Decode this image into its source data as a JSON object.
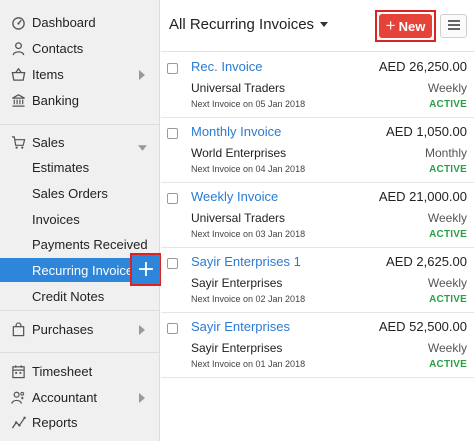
{
  "sidebar": {
    "items": [
      {
        "label": "Dashboard",
        "icon": "dashboard-icon"
      },
      {
        "label": "Contacts",
        "icon": "person-icon"
      },
      {
        "label": "Items",
        "icon": "basket-icon"
      },
      {
        "label": "Banking",
        "icon": "bank-icon"
      },
      {
        "label": "Sales",
        "icon": "cart-icon"
      },
      {
        "label": "Estimates"
      },
      {
        "label": "Sales Orders"
      },
      {
        "label": "Invoices"
      },
      {
        "label": "Payments Received"
      },
      {
        "label": "Recurring Invoices"
      },
      {
        "label": "Credit Notes"
      },
      {
        "label": "Purchases",
        "icon": "bag-icon"
      },
      {
        "label": "Timesheet",
        "icon": "calendar-icon"
      },
      {
        "label": "Accountant",
        "icon": "accountant-icon"
      },
      {
        "label": "Reports",
        "icon": "chart-line-icon"
      }
    ],
    "add_symbol": "+",
    "active_color": "#2d86d9"
  },
  "header": {
    "title": "All Recurring Invoices",
    "new_button": "New",
    "new_button_symbol": "+",
    "accent_color": "#e5423a",
    "menu_icon": "hamburger-icon"
  },
  "invoices": [
    {
      "name": "Rec. Invoice",
      "amount": "AED 26,250.00",
      "customer": "Universal Traders",
      "frequency": "Weekly",
      "next": "Next Invoice on 05 Jan 2018",
      "status": "ACTIVE"
    },
    {
      "name": "Monthly Invoice",
      "amount": "AED 1,050.00",
      "customer": "World Enterprises",
      "frequency": "Monthly",
      "next": "Next Invoice on 04 Jan 2018",
      "status": "ACTIVE"
    },
    {
      "name": "Weekly Invoice",
      "amount": "AED 21,000.00",
      "customer": "Universal Traders",
      "frequency": "Weekly",
      "next": "Next Invoice on 03 Jan 2018",
      "status": "ACTIVE"
    },
    {
      "name": "Sayir Enterprises 1",
      "amount": "AED 2,625.00",
      "customer": "Sayir Enterprises",
      "frequency": "Weekly",
      "next": "Next Invoice on 02 Jan 2018",
      "status": "ACTIVE"
    },
    {
      "name": "Sayir Enterprises",
      "amount": "AED 52,500.00",
      "customer": "Sayir Enterprises",
      "frequency": "Weekly",
      "next": "Next Invoice on 01 Jan 2018",
      "status": "ACTIVE"
    }
  ],
  "status_color": "#2aa146",
  "link_color": "#2b7bd3"
}
